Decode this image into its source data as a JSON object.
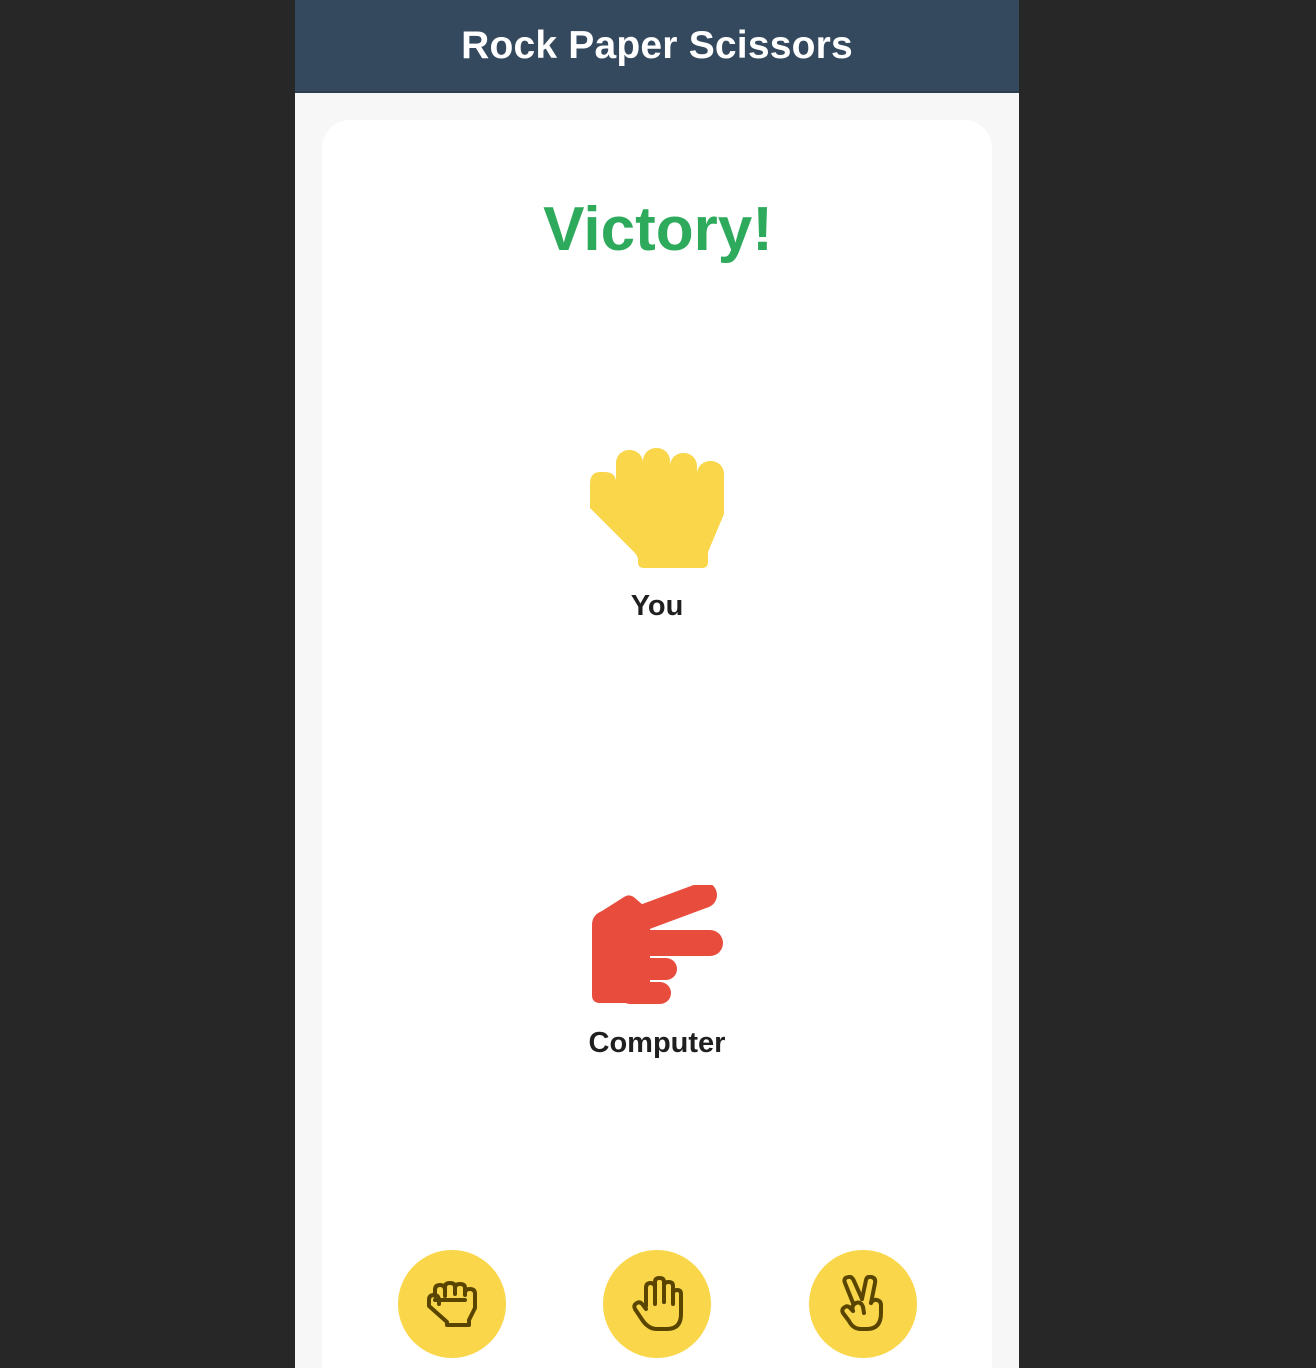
{
  "header": {
    "title": "Rock Paper Scissors"
  },
  "result": {
    "text": "Victory!",
    "color": "#2daa5c"
  },
  "players": {
    "you": {
      "label": "You",
      "choice": "rock",
      "icon": "rock-fist-icon",
      "color": "#f9d64a"
    },
    "computer": {
      "label": "Computer",
      "choice": "scissors",
      "icon": "scissors-hand-icon",
      "color": "#e74c3c"
    }
  },
  "choices": [
    {
      "name": "rock",
      "icon": "rock-outline-icon"
    },
    {
      "name": "paper",
      "icon": "paper-outline-icon"
    },
    {
      "name": "scissors",
      "icon": "scissors-outline-icon"
    }
  ],
  "colors": {
    "header_bg": "#34495e",
    "button_bg": "#f9d64a",
    "button_icon": "#5a4500",
    "page_bg": "#272727"
  }
}
